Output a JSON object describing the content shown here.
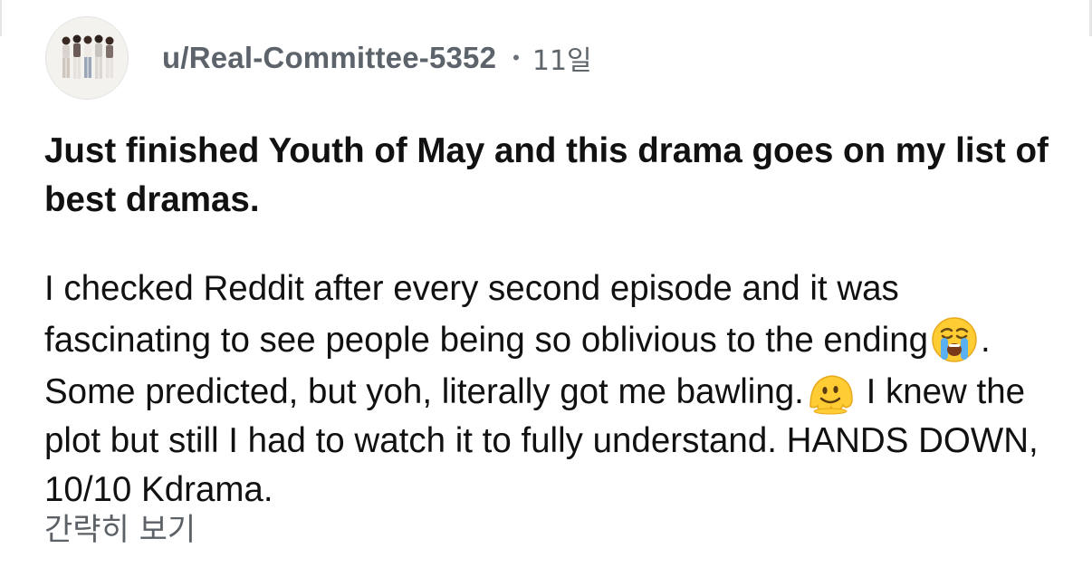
{
  "post": {
    "username": "u/Real-Committee-5352",
    "separator": "•",
    "age": "11일",
    "title": "Just finished Youth of May and this drama goes on my list of best dramas.",
    "body": {
      "segment_1": "I checked Reddit after every second episode and it was fascinating to see people being so oblivious to the ending",
      "emoji_1": "loudly-crying-face",
      "segment_2": ". Some predicted, but yoh, literally got me bawling.",
      "emoji_2": "melting-face",
      "segment_3": " I knew the plot but still I had to watch it to fully understand. HANDS DOWN, 10/10 Kdrama."
    },
    "collapse_label": "간략히 보기"
  },
  "colors": {
    "text": "#111111",
    "meta": "#5c636a",
    "emoji_yellow": "#ffcc33",
    "tears_blue": "#5ab0f0"
  },
  "icons": {
    "avatar": "group-photo-avatar"
  }
}
